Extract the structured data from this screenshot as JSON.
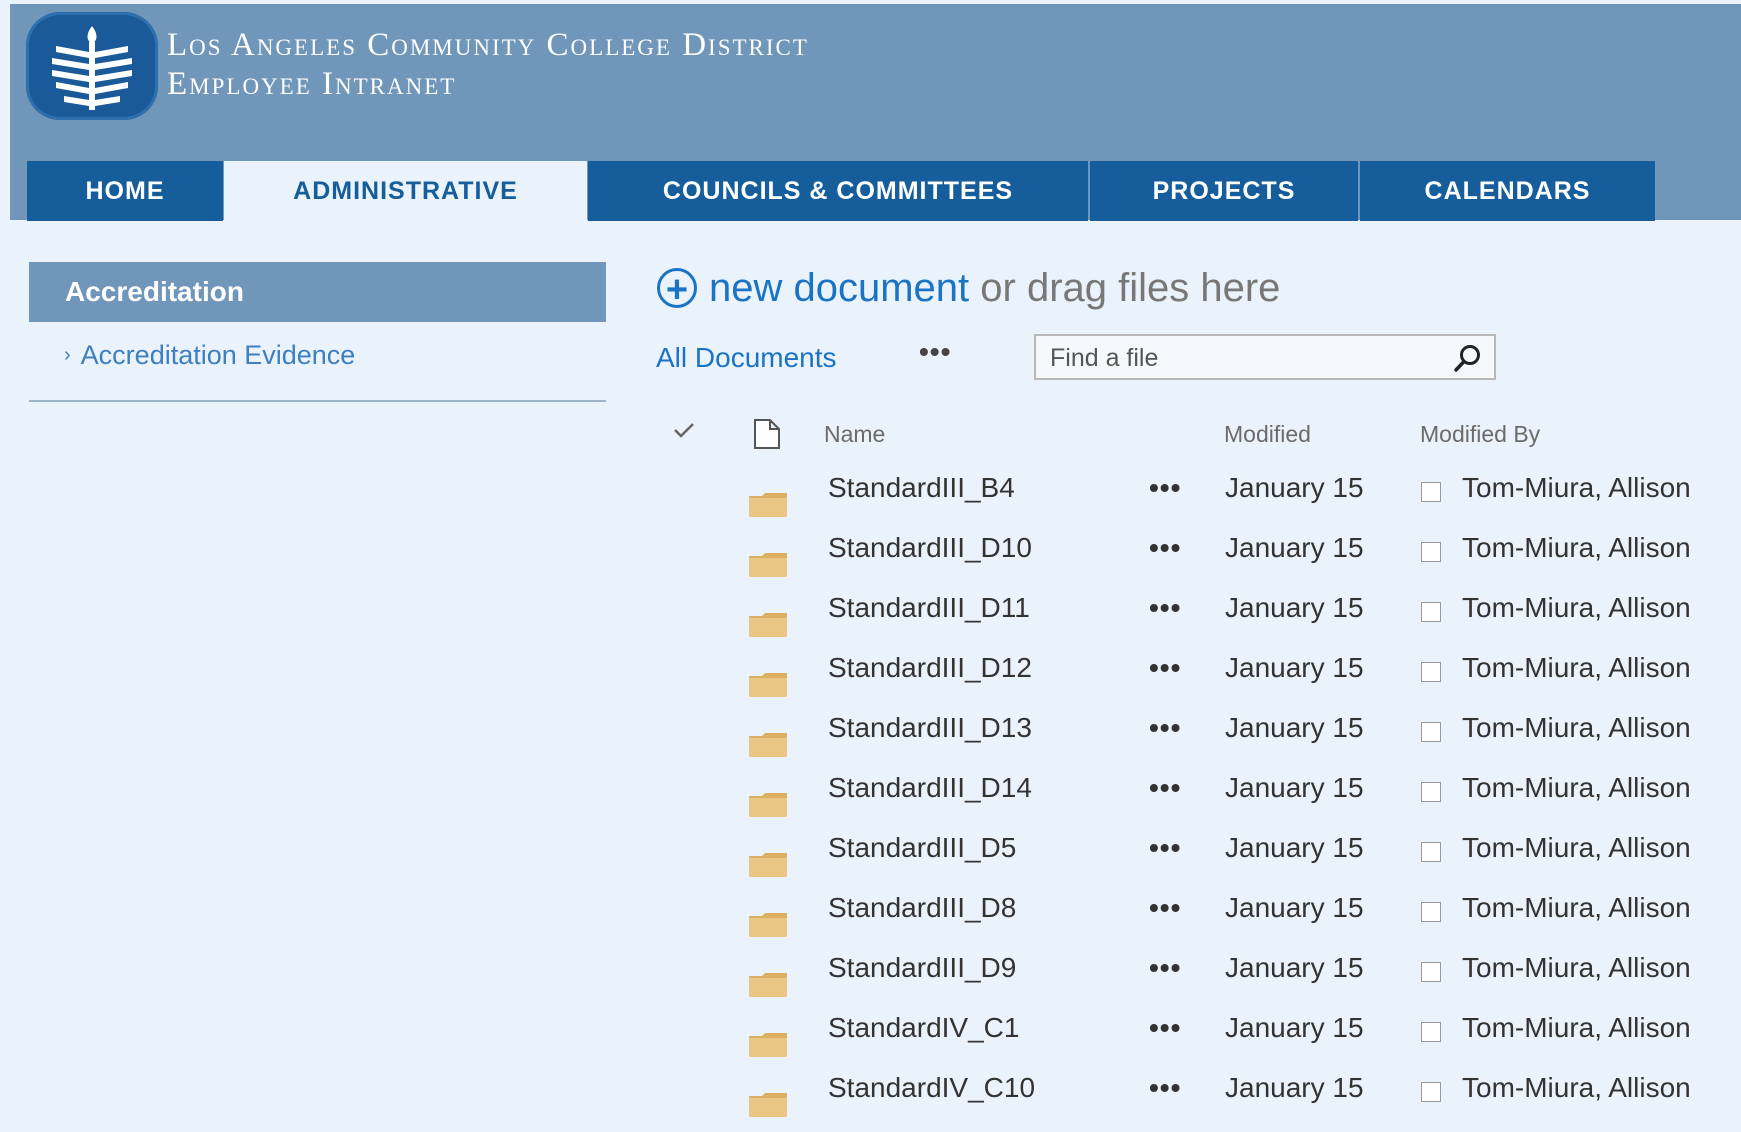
{
  "header": {
    "title_line1": "Los Angeles Community College District",
    "title_line2": "Employee Intranet",
    "logo_icon": "wheat-seal-icon"
  },
  "nav": {
    "tabs": [
      {
        "label": "HOME",
        "active": false
      },
      {
        "label": "ADMINISTRATIVE",
        "active": true
      },
      {
        "label": "COUNCILS & COMMITTEES",
        "active": false
      },
      {
        "label": "PROJECTS",
        "active": false
      },
      {
        "label": "CALENDARS",
        "active": false
      }
    ]
  },
  "sidebar": {
    "title": "Accreditation",
    "link": "Accreditation Evidence",
    "link_chevron": "›"
  },
  "library": {
    "new_document": "new document",
    "drag_text": " or drag files here",
    "plus_symbol": "+",
    "view": "All Documents",
    "more": "•••",
    "search_placeholder": "Find a file",
    "columns": {
      "name": "Name",
      "modified": "Modified",
      "modified_by": "Modified By"
    },
    "row_more": "•••",
    "rows": [
      {
        "name": "StandardIII_B4",
        "modified": "January 15",
        "modified_by": "Tom-Miura, Allison"
      },
      {
        "name": "StandardIII_D10",
        "modified": "January 15",
        "modified_by": "Tom-Miura, Allison"
      },
      {
        "name": "StandardIII_D11",
        "modified": "January 15",
        "modified_by": "Tom-Miura, Allison"
      },
      {
        "name": "StandardIII_D12",
        "modified": "January 15",
        "modified_by": "Tom-Miura, Allison"
      },
      {
        "name": "StandardIII_D13",
        "modified": "January 15",
        "modified_by": "Tom-Miura, Allison"
      },
      {
        "name": "StandardIII_D14",
        "modified": "January 15",
        "modified_by": "Tom-Miura, Allison"
      },
      {
        "name": "StandardIII_D5",
        "modified": "January 15",
        "modified_by": "Tom-Miura, Allison"
      },
      {
        "name": "StandardIII_D8",
        "modified": "January 15",
        "modified_by": "Tom-Miura, Allison"
      },
      {
        "name": "StandardIII_D9",
        "modified": "January 15",
        "modified_by": "Tom-Miura, Allison"
      },
      {
        "name": "StandardIV_C1",
        "modified": "January 15",
        "modified_by": "Tom-Miura, Allison"
      },
      {
        "name": "StandardIV_C10",
        "modified": "January 15",
        "modified_by": "Tom-Miura, Allison"
      }
    ]
  },
  "colors": {
    "header_bg": "#7096b9",
    "tab_bg": "#155d9b",
    "page_bg": "#eaf2fb",
    "link": "#1a73c4",
    "folder": "#e8c280"
  }
}
